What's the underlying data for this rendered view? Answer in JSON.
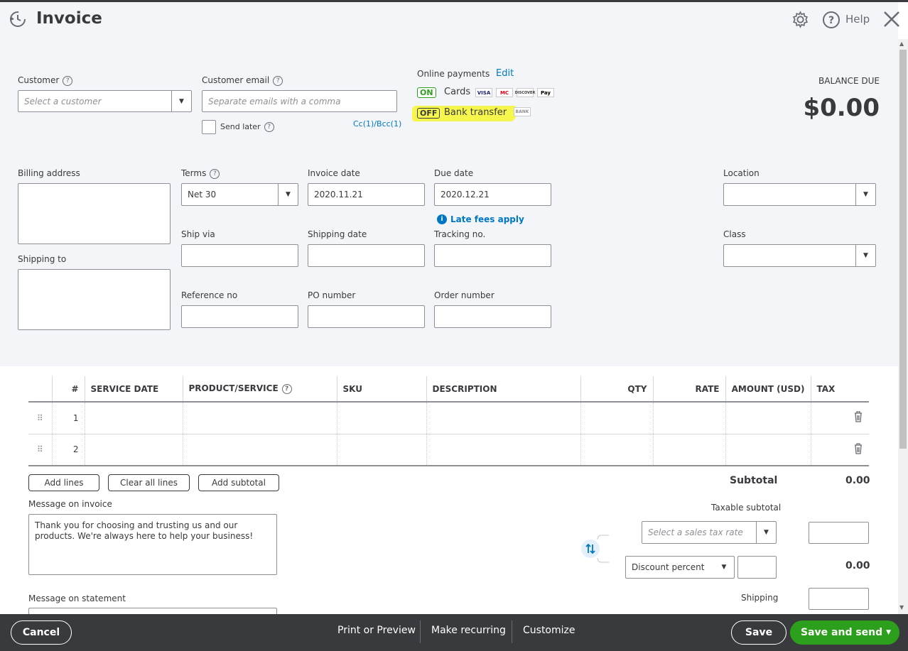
{
  "header": {
    "title": "Invoice",
    "help_label": "Help"
  },
  "customer": {
    "label": "Customer",
    "placeholder": "Select a customer"
  },
  "customer_email": {
    "label": "Customer email",
    "placeholder": "Separate emails with a comma",
    "send_later_label": "Send later",
    "cc_bcc_link": "Cc(1)/Bcc(1)"
  },
  "online_payments": {
    "label": "Online payments",
    "edit_link": "Edit",
    "cards_toggle": "ON",
    "cards_label": "Cards",
    "card_logos": [
      "VISA",
      "MC",
      "DISCOVER",
      "Pay"
    ],
    "bank_toggle": "OFF",
    "bank_label": "Bank transfer",
    "bank_logo": "BANK"
  },
  "balance": {
    "label": "BALANCE DUE",
    "amount": "$0.00"
  },
  "fields": {
    "billing_address_label": "Billing address",
    "shipping_to_label": "Shipping to",
    "terms_label": "Terms",
    "terms_value": "Net 30",
    "invoice_date_label": "Invoice date",
    "invoice_date_value": "2020.11.21",
    "due_date_label": "Due date",
    "due_date_value": "2020.12.21",
    "late_fees_label": "Late fees apply",
    "location_label": "Location",
    "class_label": "Class",
    "ship_via_label": "Ship via",
    "shipping_date_label": "Shipping date",
    "tracking_label": "Tracking no.",
    "reference_label": "Reference no",
    "po_label": "PO number",
    "order_label": "Order number"
  },
  "table": {
    "columns": [
      "#",
      "SERVICE DATE",
      "PRODUCT/SERVICE",
      "SKU",
      "DESCRIPTION",
      "QTY",
      "RATE",
      "AMOUNT (USD)",
      "TAX"
    ],
    "rows": [
      {
        "num": "1"
      },
      {
        "num": "2"
      }
    ]
  },
  "line_buttons": {
    "add_lines": "Add lines",
    "clear_all": "Clear all lines",
    "add_subtotal": "Add subtotal"
  },
  "totals": {
    "subtotal_label": "Subtotal",
    "subtotal_value": "0.00",
    "taxable_label": "Taxable subtotal",
    "tax_rate_placeholder": "Select a sales tax rate",
    "discount_type": "Discount percent",
    "discount_value": "0.00",
    "shipping_label": "Shipping"
  },
  "messages": {
    "invoice_label": "Message on invoice",
    "invoice_text": "Thank you for choosing and trusting us and our products. We're always here to help your business!",
    "statement_label": "Message on statement"
  },
  "footer": {
    "cancel": "Cancel",
    "print_preview": "Print or Preview",
    "make_recurring": "Make recurring",
    "customize": "Customize",
    "save": "Save",
    "save_and_send": "Save and send"
  },
  "colors": {
    "primary_green": "#2ca01c",
    "link_blue": "#0077c5",
    "highlight": "#f7f542",
    "footer_bg": "#393a3d"
  }
}
